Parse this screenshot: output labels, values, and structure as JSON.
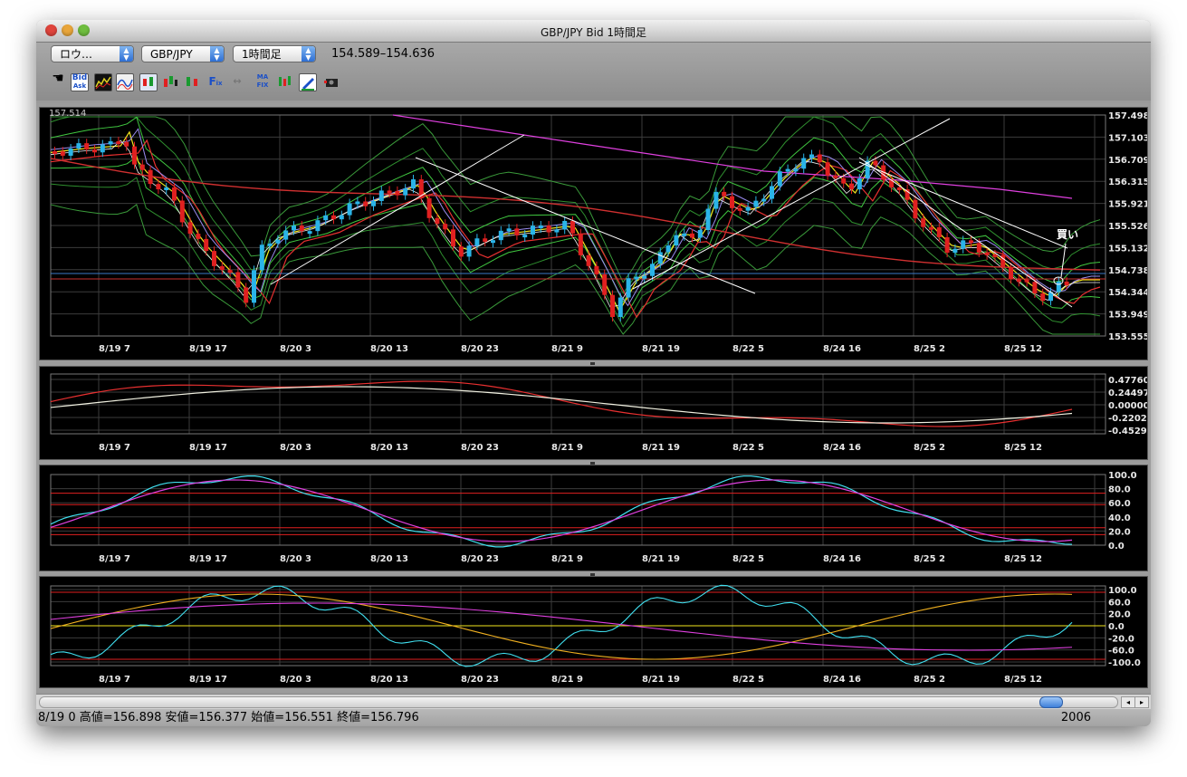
{
  "window": {
    "title": "GBP/JPY Bid 1時間足"
  },
  "toolbar": {
    "chart_type_popup": "ロウ…",
    "symbol_popup": "GBP/JPY",
    "timeframe_popup": "1時間足",
    "price_range": "154.589–154.636",
    "tools": [
      {
        "name": "hand-tool-icon",
        "label": ""
      },
      {
        "name": "bid-ask-icon",
        "label": "Bid Ask"
      },
      {
        "name": "chart-icon-1",
        "label": ""
      },
      {
        "name": "chart-icon-2",
        "label": ""
      },
      {
        "name": "candle-icon-1",
        "label": ""
      },
      {
        "name": "candle-icon-2",
        "label": ""
      },
      {
        "name": "candle-icon-3",
        "label": ""
      },
      {
        "name": "fix-icon",
        "label": "Fix"
      },
      {
        "name": "ma-fix-icon",
        "label": "MA FIX"
      },
      {
        "name": "candle-icon-4",
        "label": ""
      },
      {
        "name": "pencil-icon",
        "label": ""
      },
      {
        "name": "camera-icon",
        "label": ""
      }
    ]
  },
  "main_chart": {
    "top_left_value": "157.514",
    "price_labels": [
      "157.498",
      "157.103",
      "156.709",
      "156.315",
      "155.921",
      "155.526",
      "155.132",
      "154.738",
      "154.344",
      "153.949",
      "153.555"
    ],
    "annotation": "買い"
  },
  "time_labels": [
    "8/19 7",
    "8/19 17",
    "8/20 3",
    "8/20 13",
    "8/20 23",
    "8/21 9",
    "8/21 19",
    "8/22 5",
    "8/24 16",
    "8/25 2",
    "8/25 12"
  ],
  "macd_pane": {
    "labels": [
      "0.47760",
      "0.24497",
      "0.00000",
      "-0.22028",
      "-0.45291"
    ]
  },
  "stoch_pane": {
    "labels": [
      "100.0",
      "80.0",
      "60.0",
      "40.0",
      "20.0",
      "0.0"
    ]
  },
  "cci_pane": {
    "labels": [
      "100.0",
      "60.0",
      "20.0",
      "0.0",
      "-20.0",
      "-60.0",
      "-100.0"
    ]
  },
  "status": {
    "left": "8/19 0  高値=156.898 安値=156.377 始値=156.551 終値=156.796",
    "right": "2006"
  },
  "colors": {
    "up": "#2ab4e8",
    "down": "#e02020",
    "grid": "#3c3c3c",
    "magenta": "#e040e0",
    "yellow": "#f2e61e",
    "cyan": "#40e0f0",
    "green": "#40c840"
  }
}
